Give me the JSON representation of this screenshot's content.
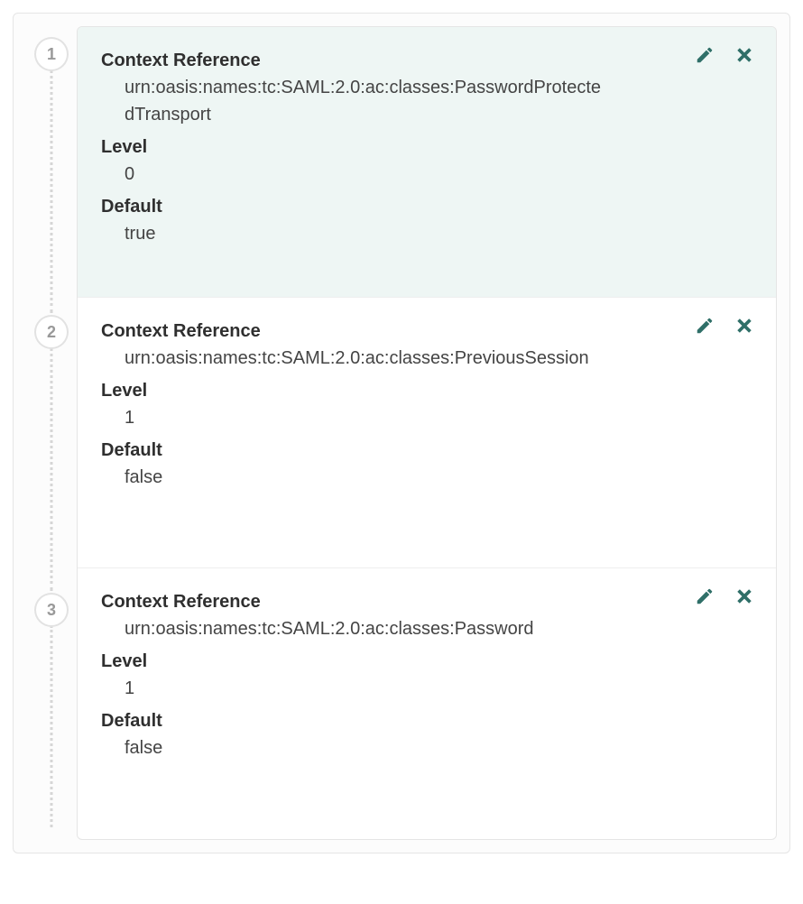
{
  "labels": {
    "context_reference": "Context Reference",
    "level": "Level",
    "default": "Default"
  },
  "icons": {
    "edit": "pencil",
    "delete": "x"
  },
  "items": [
    {
      "step": "1",
      "active": true,
      "context_reference": "urn:oasis:names:tc:SAML:2.0:ac:classes:PasswordProtectedTransport",
      "level": "0",
      "default": "true"
    },
    {
      "step": "2",
      "active": false,
      "context_reference": "urn:oasis:names:tc:SAML:2.0:ac:classes:PreviousSession",
      "level": "1",
      "default": "false"
    },
    {
      "step": "3",
      "active": false,
      "context_reference": "urn:oasis:names:tc:SAML:2.0:ac:classes:Password",
      "level": "1",
      "default": "false"
    }
  ]
}
